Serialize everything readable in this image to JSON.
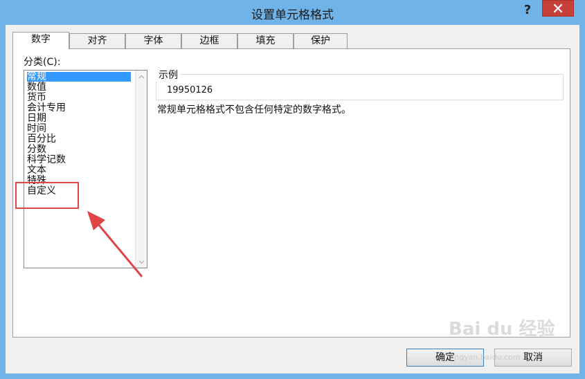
{
  "window": {
    "title": "设置单元格格式",
    "help_label": "?",
    "close_icon": "close-icon"
  },
  "tabs": [
    {
      "label": "数字",
      "active": true
    },
    {
      "label": "对齐",
      "active": false
    },
    {
      "label": "字体",
      "active": false
    },
    {
      "label": "边框",
      "active": false
    },
    {
      "label": "填充",
      "active": false
    },
    {
      "label": "保护",
      "active": false
    }
  ],
  "category": {
    "label": "分类(C):",
    "items": [
      "常规",
      "数值",
      "货币",
      "会计专用",
      "日期",
      "时间",
      "百分比",
      "分数",
      "科学记数",
      "文本",
      "特殊",
      "自定义"
    ],
    "selected": "常规"
  },
  "sample": {
    "label": "示例",
    "value": "19950126"
  },
  "description": "常规单元格格式不包含任何特定的数字格式。",
  "buttons": {
    "ok": "确定",
    "cancel": "取消"
  },
  "annotation": {
    "color": "#e04545",
    "target": "自定义"
  },
  "watermark": {
    "text": "Bai du 经验",
    "sub": "jingyan.baidu.com"
  },
  "colors": {
    "selection": "#3399ff",
    "frame": "#6fb3e8",
    "close": "#c7413b"
  }
}
